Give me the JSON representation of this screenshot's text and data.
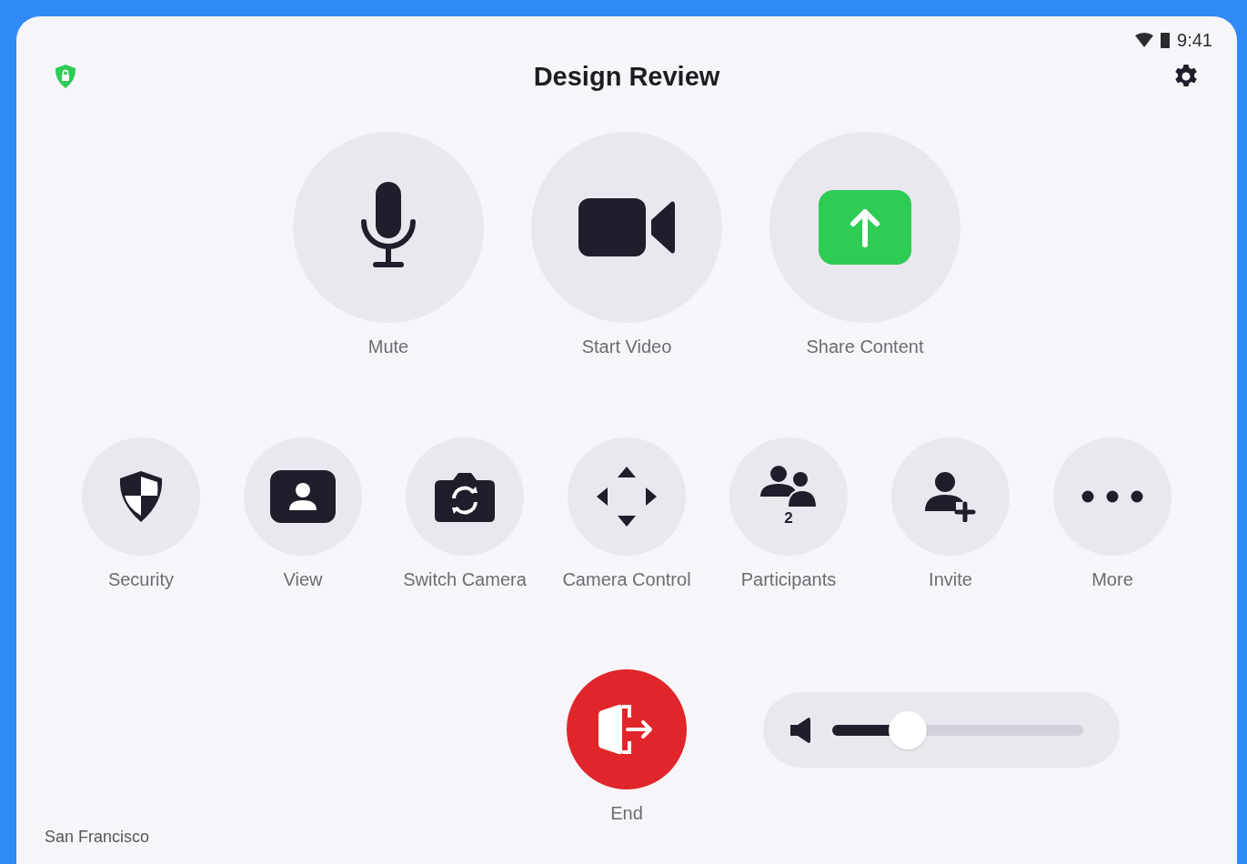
{
  "status_bar": {
    "time": "9:41"
  },
  "title": "Design Review",
  "primary_actions": [
    {
      "label": "Mute",
      "kind": "mic"
    },
    {
      "label": "Start Video",
      "kind": "video"
    },
    {
      "label": "Share Content",
      "kind": "share"
    }
  ],
  "secondary_actions": [
    {
      "label": "Security",
      "kind": "security"
    },
    {
      "label": "View",
      "kind": "view"
    },
    {
      "label": "Switch Camera",
      "kind": "switch-camera"
    },
    {
      "label": "Camera Control",
      "kind": "camera-control"
    },
    {
      "label": "Participants",
      "kind": "participants",
      "count": "2"
    },
    {
      "label": "Invite",
      "kind": "invite"
    },
    {
      "label": "More",
      "kind": "more"
    }
  ],
  "end_button": {
    "label": "End"
  },
  "volume": {
    "level": 0.3
  },
  "location": "San Francisco"
}
